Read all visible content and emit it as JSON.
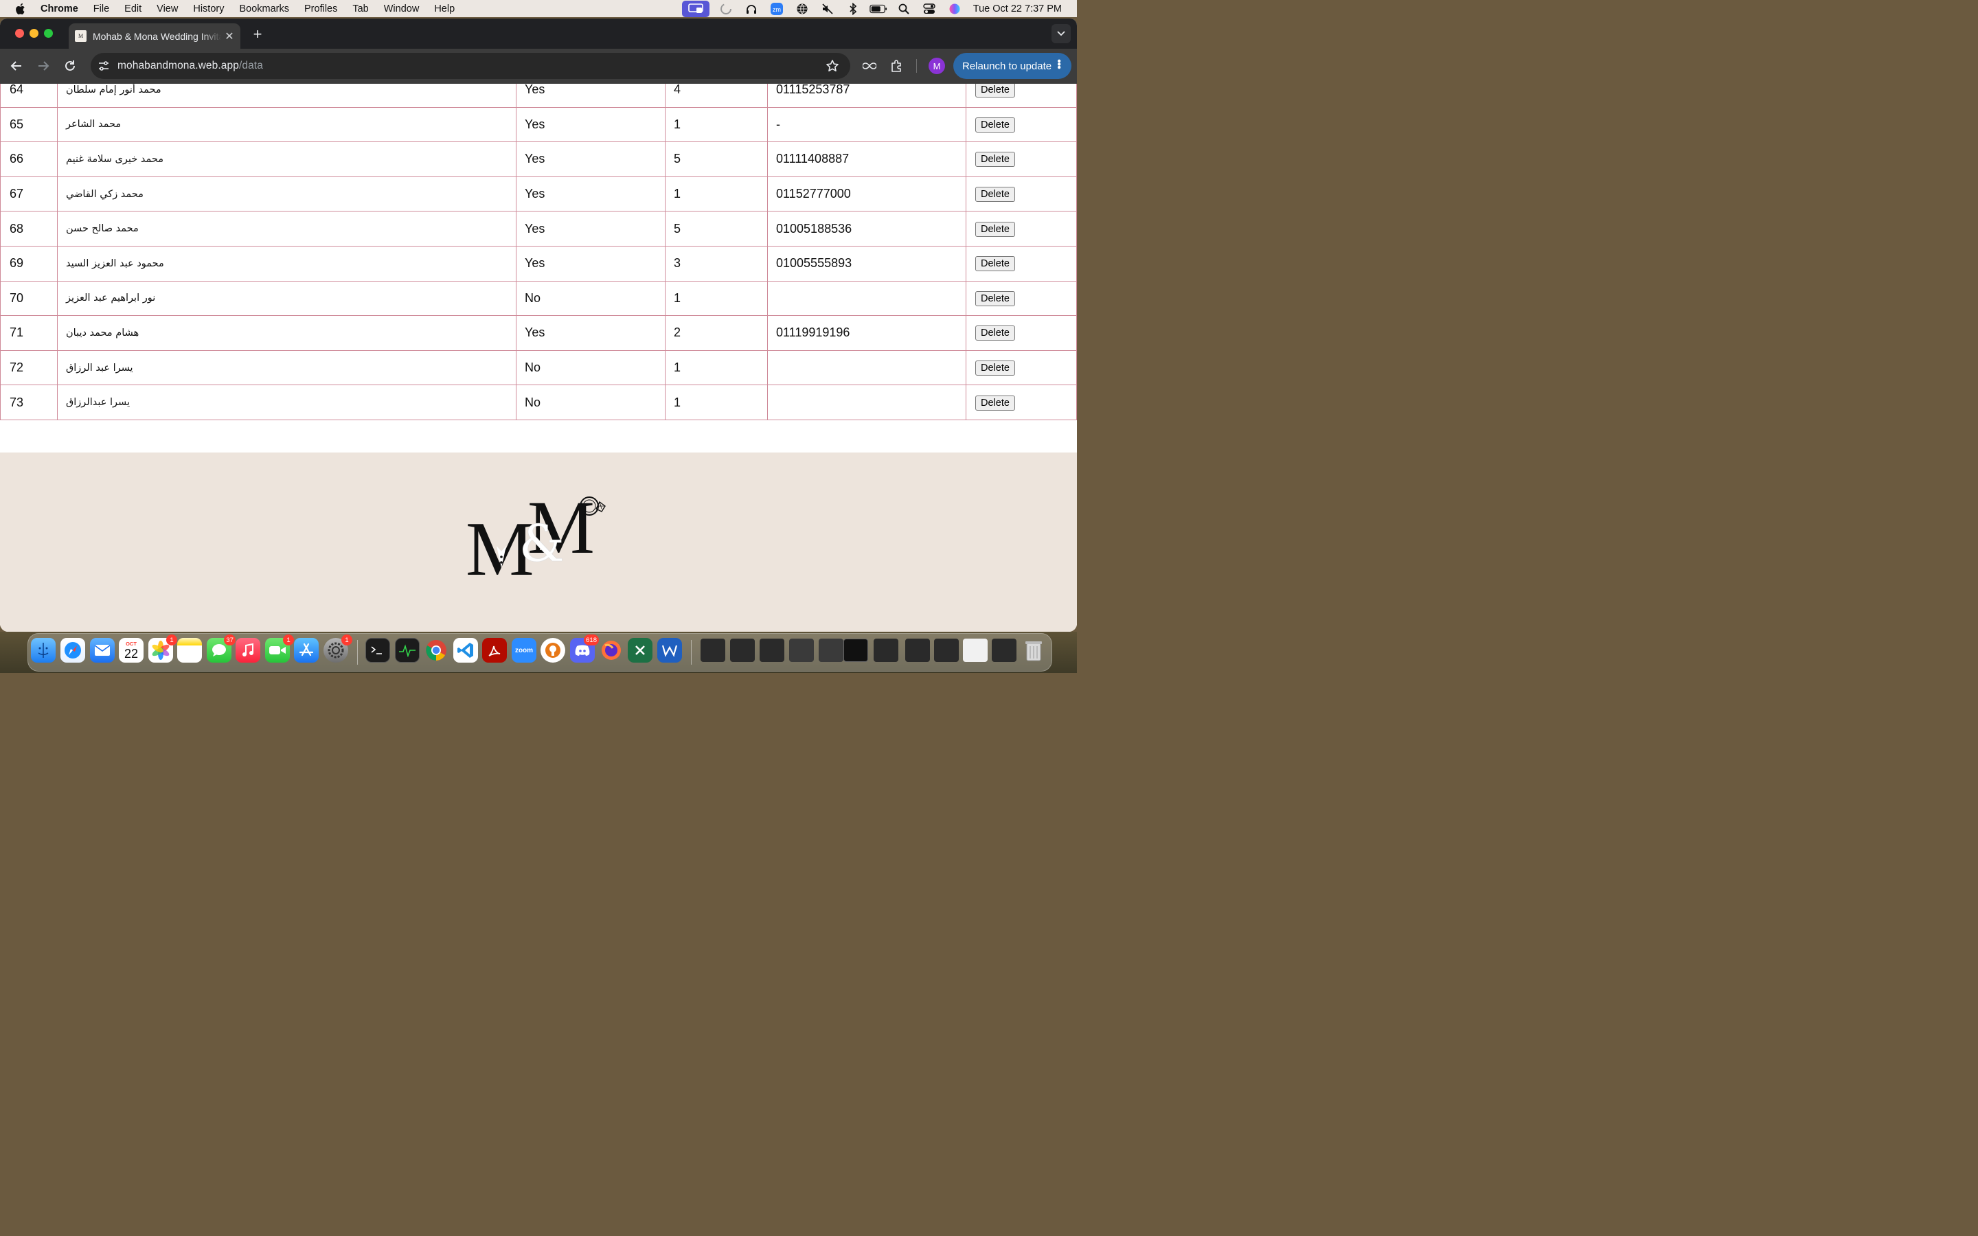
{
  "menubar": {
    "app": "Chrome",
    "items": [
      "File",
      "Edit",
      "View",
      "History",
      "Bookmarks",
      "Profiles",
      "Tab",
      "Window",
      "Help"
    ],
    "clock": "Tue Oct 22  7:37 PM"
  },
  "browser": {
    "tab_title": "Mohab & Mona Wedding Invitation",
    "url_host": "mohabandmona.web.app",
    "url_path": "/data",
    "relaunch_label": "Relaunch to update",
    "avatar_letter": "M"
  },
  "table": {
    "delete_label": "Delete",
    "rows": [
      {
        "num": "64",
        "name": "محمد أنور إمام سلطان",
        "attending": "Yes",
        "count": "4",
        "phone": "01115253787"
      },
      {
        "num": "65",
        "name": "محمد الشاعر",
        "attending": "Yes",
        "count": "1",
        "phone": "-"
      },
      {
        "num": "66",
        "name": "محمد خيرى سلامة غنيم",
        "attending": "Yes",
        "count": "5",
        "phone": "01111408887"
      },
      {
        "num": "67",
        "name": "محمد زكي القاضي",
        "attending": "Yes",
        "count": "1",
        "phone": "01152777000"
      },
      {
        "num": "68",
        "name": "محمد صالح حسن",
        "attending": "Yes",
        "count": "5",
        "phone": "01005188536"
      },
      {
        "num": "69",
        "name": "محمود عبد العزيز السيد",
        "attending": "Yes",
        "count": "3",
        "phone": "01005555893"
      },
      {
        "num": "70",
        "name": "نور ابراهيم عبد العزيز",
        "attending": "No",
        "count": "1",
        "phone": ""
      },
      {
        "num": "71",
        "name": "هشام محمد ديبان",
        "attending": "Yes",
        "count": "2",
        "phone": "01119919196"
      },
      {
        "num": "72",
        "name": "يسرا عبد الرزاق",
        "attending": "No",
        "count": "1",
        "phone": ""
      },
      {
        "num": "73",
        "name": "يسرا عبدالرزاق",
        "attending": "No",
        "count": "1",
        "phone": ""
      }
    ]
  },
  "footer": {
    "logo_text": "M&M"
  },
  "dock": {
    "calendar_month": "OCT",
    "calendar_day": "22",
    "badges": {
      "photos": "1",
      "messages": "37",
      "facetime": "1",
      "settings": "1",
      "discord": "618"
    },
    "zoom_label": "zoom"
  },
  "colors": {
    "table_border": "#cf8a99",
    "footer_bg": "#ede4dc",
    "relaunch_bg": "#2b69a8",
    "chrome_dark": "#3c3c3c"
  }
}
